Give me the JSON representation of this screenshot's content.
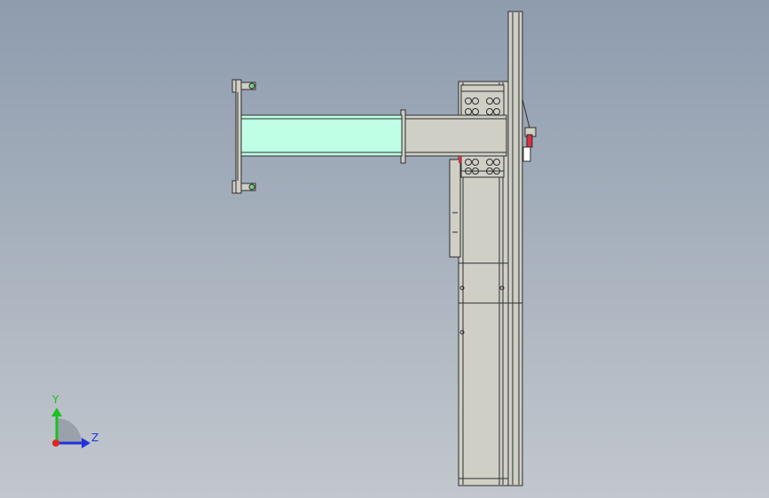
{
  "viewport": {
    "background_top": "#8e9cae",
    "background_bottom": "#c2c7cd"
  },
  "colors": {
    "beam_fill": "#bfffe6",
    "steel_fill": "#cfcfc6",
    "outline": "#2e2e2e",
    "axis_y": "#19c21f",
    "axis_z": "#2233dd",
    "axis_origin": "#e0261d",
    "handle_red": "#d8303c"
  },
  "triad": {
    "y_label": "Y",
    "z_label": "Z",
    "icons": [
      "axis-y-arrow-icon",
      "axis-z-arrow-icon",
      "axis-origin-icon"
    ]
  }
}
